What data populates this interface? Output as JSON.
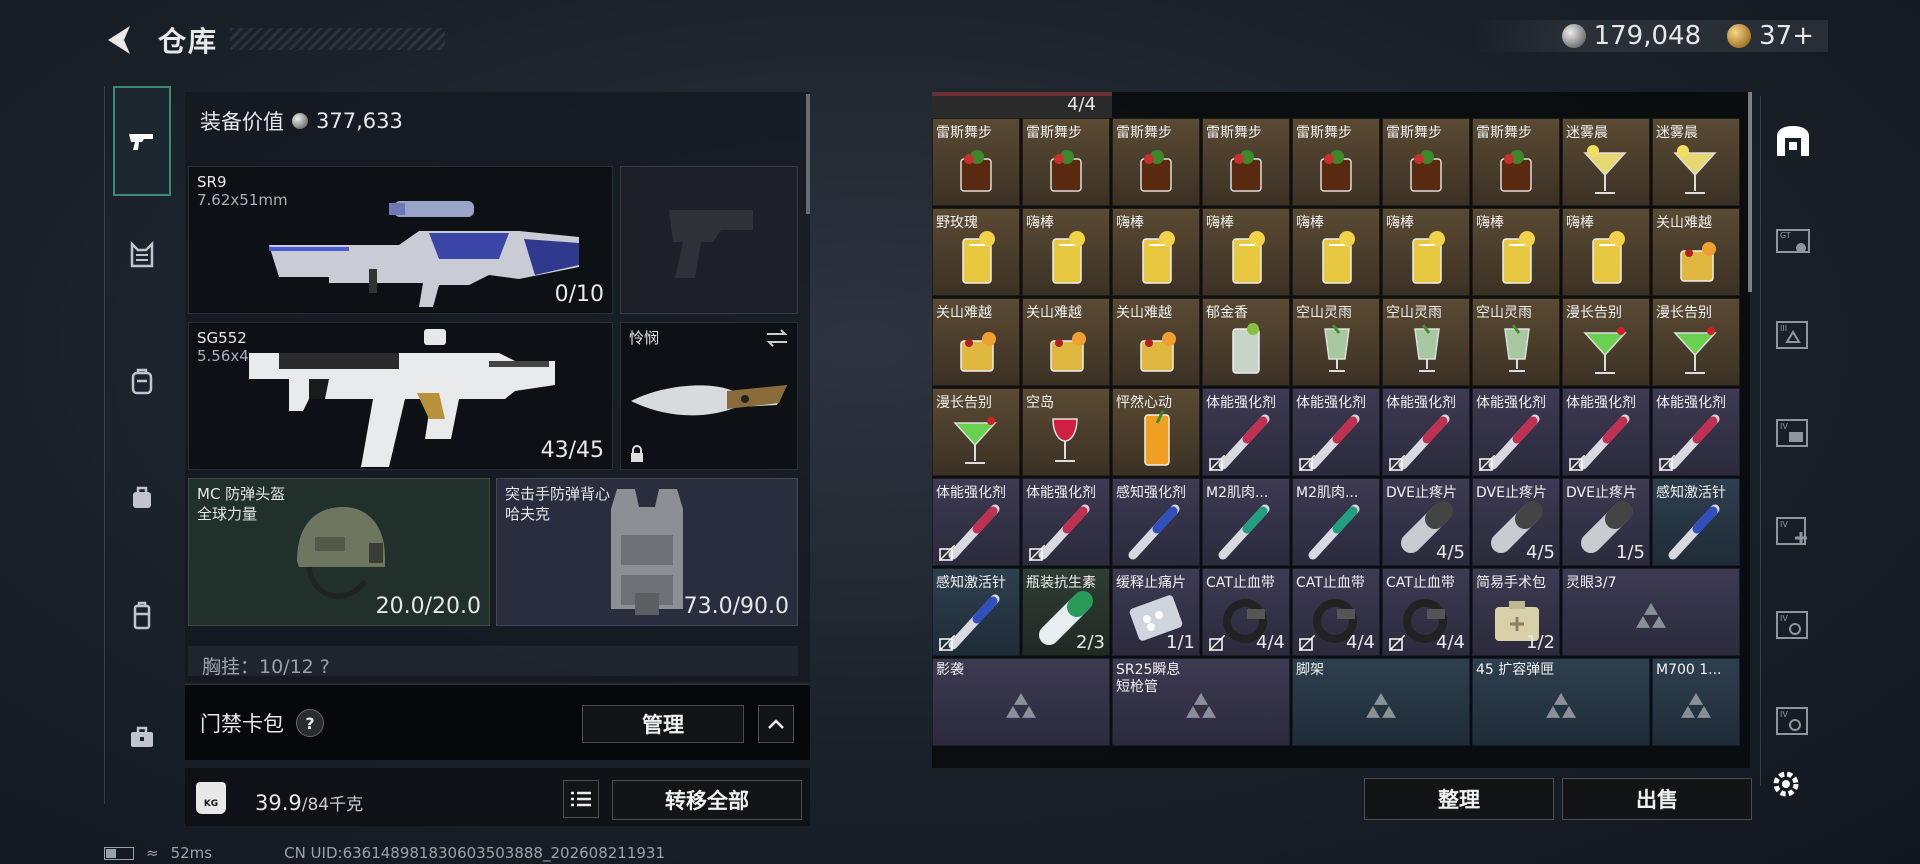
{
  "header": {
    "title": "仓库",
    "silver_amount": "179,048",
    "gold_amount": "37+"
  },
  "equipment": {
    "value_label": "装备价值",
    "value": "377,633",
    "primary": {
      "name": "SR9",
      "caliber": "7.62x51mm",
      "ammo": "0/10"
    },
    "secondary": {
      "name": "SG552",
      "caliber": "5.56x4",
      "ammo": "43/45"
    },
    "melee": {
      "name": "怜悯"
    },
    "helmet": {
      "name": "MC 防弹头盔",
      "sub": "全球力量",
      "durability": "20.0/20.0"
    },
    "armor": {
      "name": "突击手防弹背心",
      "sub": "哈夫克",
      "durability": "73.0/90.0"
    },
    "chest_partial": "胸挂：10/12 ?"
  },
  "keycard": {
    "label": "门禁卡包",
    "help": "?",
    "manage_label": "管理"
  },
  "weight": {
    "current": "39.9",
    "max": "/84千克",
    "transfer_all_label": "转移全部"
  },
  "grid": {
    "top_partial_count": "4/4",
    "rows": [
      [
        {
          "label": "雷斯舞步",
          "color": "brown",
          "icon": "cocktail-brown"
        },
        {
          "label": "雷斯舞步",
          "color": "brown",
          "icon": "cocktail-brown"
        },
        {
          "label": "雷斯舞步",
          "color": "brown",
          "icon": "cocktail-brown"
        },
        {
          "label": "雷斯舞步",
          "color": "brown",
          "icon": "cocktail-brown"
        },
        {
          "label": "雷斯舞步",
          "color": "brown",
          "icon": "cocktail-brown"
        },
        {
          "label": "雷斯舞步",
          "color": "brown",
          "icon": "cocktail-brown"
        },
        {
          "label": "雷斯舞步",
          "color": "brown",
          "icon": "cocktail-brown"
        },
        {
          "label": "迷雾晨",
          "color": "brown",
          "icon": "martini-yellow"
        },
        {
          "label": "迷雾晨",
          "color": "brown",
          "icon": "martini-yellow"
        }
      ],
      [
        {
          "label": "野玫瑰",
          "color": "brown",
          "icon": "highball-yellow"
        },
        {
          "label": "嗨棒",
          "color": "brown",
          "icon": "highball-yellow"
        },
        {
          "label": "嗨棒",
          "color": "brown",
          "icon": "highball-yellow"
        },
        {
          "label": "嗨棒",
          "color": "brown",
          "icon": "highball-yellow"
        },
        {
          "label": "嗨棒",
          "color": "brown",
          "icon": "highball-yellow"
        },
        {
          "label": "嗨棒",
          "color": "brown",
          "icon": "highball-yellow"
        },
        {
          "label": "嗨棒",
          "color": "brown",
          "icon": "highball-yellow"
        },
        {
          "label": "嗨棒",
          "color": "brown",
          "icon": "highball-yellow"
        },
        {
          "label": "关山难越",
          "color": "brown",
          "icon": "rocks-yellow"
        }
      ],
      [
        {
          "label": "关山难越",
          "color": "brown",
          "icon": "rocks-yellow"
        },
        {
          "label": "关山难越",
          "color": "brown",
          "icon": "rocks-yellow"
        },
        {
          "label": "关山难越",
          "color": "brown",
          "icon": "rocks-yellow"
        },
        {
          "label": "郁金香",
          "color": "brown",
          "icon": "highball-clear"
        },
        {
          "label": "空山灵雨",
          "color": "brown",
          "icon": "tall-green"
        },
        {
          "label": "空山灵雨",
          "color": "brown",
          "icon": "tall-green"
        },
        {
          "label": "空山灵雨",
          "color": "brown",
          "icon": "tall-green"
        },
        {
          "label": "漫长告别",
          "color": "brown",
          "icon": "martini-green"
        },
        {
          "label": "漫长告别",
          "color": "brown",
          "icon": "martini-green"
        }
      ],
      [
        {
          "label": "漫长告别",
          "color": "brown",
          "icon": "martini-green"
        },
        {
          "label": "空岛",
          "color": "brown",
          "icon": "wine-red"
        },
        {
          "label": "怦然心动",
          "color": "brown",
          "icon": "tall-orange"
        },
        {
          "label": "体能强化剂",
          "color": "purple",
          "icon": "injector-red",
          "nosell": true
        },
        {
          "label": "体能强化剂",
          "color": "purple",
          "icon": "injector-red",
          "nosell": true
        },
        {
          "label": "体能强化剂",
          "color": "purple",
          "icon": "injector-red",
          "nosell": true
        },
        {
          "label": "体能强化剂",
          "color": "purple",
          "icon": "injector-red",
          "nosell": true
        },
        {
          "label": "体能强化剂",
          "color": "purple",
          "icon": "injector-red",
          "nosell": true
        },
        {
          "label": "体能强化剂",
          "color": "purple",
          "icon": "injector-red",
          "nosell": true
        }
      ],
      [
        {
          "label": "体能强化剂",
          "color": "purple",
          "icon": "injector-red",
          "nosell": true
        },
        {
          "label": "体能强化剂",
          "color": "purple",
          "icon": "injector-red",
          "nosell": true
        },
        {
          "label": "感知强化剂",
          "color": "purple",
          "icon": "injector-blue"
        },
        {
          "label": "M2肌肉...",
          "color": "purple",
          "icon": "injector-green"
        },
        {
          "label": "M2肌肉...",
          "color": "purple",
          "icon": "injector-green"
        },
        {
          "label": "DVE止疼片",
          "color": "purple",
          "icon": "pill-bottle",
          "count": "4/5"
        },
        {
          "label": "DVE止疼片",
          "color": "purple",
          "icon": "pill-bottle",
          "count": "4/5"
        },
        {
          "label": "DVE止疼片",
          "color": "purple",
          "icon": "pill-bottle",
          "count": "1/5"
        },
        {
          "label": "感知激活针",
          "color": "blue",
          "icon": "injector-blue"
        }
      ],
      [
        {
          "label": "感知激活针",
          "color": "blue",
          "icon": "injector-blue",
          "nosell": true
        },
        {
          "label": "瓶装抗生素",
          "color": "darkgreen",
          "icon": "antibiotic-bottle",
          "count": "2/3"
        },
        {
          "label": "缓释止痛片",
          "color": "purple",
          "icon": "blister-pack",
          "count": "1/1"
        },
        {
          "label": "CAT止血带",
          "color": "purple",
          "icon": "tourniquet",
          "count": "4/4",
          "nosell": true
        },
        {
          "label": "CAT止血带",
          "color": "purple",
          "icon": "tourniquet",
          "count": "4/4",
          "nosell": true
        },
        {
          "label": "CAT止血带",
          "color": "purple",
          "icon": "tourniquet",
          "count": "4/4",
          "nosell": true
        },
        {
          "label": "简易手术包",
          "color": "purple",
          "icon": "surgery-kit",
          "count": "1/2"
        },
        {
          "label": "灵眼3/7",
          "color": "purple",
          "icon": "placeholder-triangles",
          "span": 2
        }
      ]
    ],
    "bottom_row": [
      {
        "label": "影袭",
        "color": "purple",
        "span": 2
      },
      {
        "label": "SR25瞬息\n短枪管",
        "color": "purple",
        "span": 2
      },
      {
        "label": "脚架",
        "color": "blue",
        "span": 2
      },
      {
        "label": "45 扩容弹匣",
        "color": "blue",
        "span": 2
      },
      {
        "label": "M700 1...",
        "color": "blue",
        "span": 1
      }
    ],
    "sort_label": "整理",
    "sell_label": "出售"
  },
  "status": {
    "ping": "52ms",
    "uid": "CN UID:636148981830603503888_202608211931"
  },
  "colors": {
    "accent_green": "#3c8a72",
    "cell_brown": "#5a4a33",
    "cell_purple": "#3d3a52",
    "cell_blue": "#2e3f4e"
  }
}
